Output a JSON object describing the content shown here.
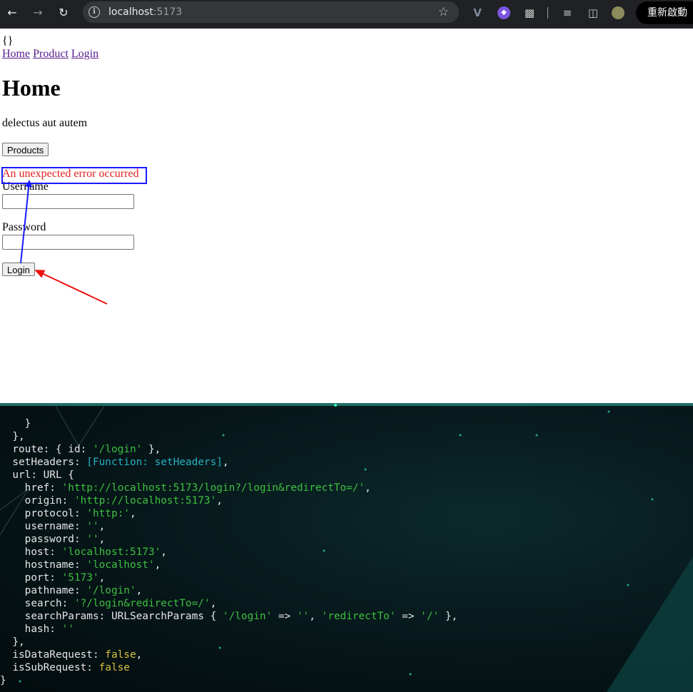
{
  "browser": {
    "url_host": "localhost",
    "url_port": ":5173",
    "restart_label": "重新啟動"
  },
  "page": {
    "braces": "{}",
    "nav": [
      "Home",
      "Product",
      "Login"
    ],
    "title": "Home",
    "description": "delectus aut autem",
    "products_button": "Products",
    "error_message": "An unexpected error occurred",
    "username_label": "Username",
    "password_label": "Password",
    "login_button": "Login"
  },
  "annotations": {
    "error_box_color": "#1a1aff",
    "blue_arrow_color": "#1a1aff",
    "red_arrow_color": "#ee1111"
  },
  "terminal": {
    "lines": [
      [
        [
          "    }",
          ""
        ]
      ],
      [
        [
          "  },",
          ""
        ]
      ],
      [
        [
          "  route: { id: ",
          ""
        ],
        [
          "'/login'",
          "g"
        ],
        [
          " },",
          ""
        ]
      ],
      [
        [
          "  setHeaders: ",
          ""
        ],
        [
          "[Function: setHeaders]",
          "c"
        ],
        [
          ",",
          ""
        ]
      ],
      [
        [
          "  url: URL {",
          ""
        ]
      ],
      [
        [
          "    href: ",
          ""
        ],
        [
          "'http://localhost:5173/login?/login&redirectTo=/'",
          "g"
        ],
        [
          ",",
          ""
        ]
      ],
      [
        [
          "    origin: ",
          ""
        ],
        [
          "'http://localhost:5173'",
          "g"
        ],
        [
          ",",
          ""
        ]
      ],
      [
        [
          "    protocol: ",
          ""
        ],
        [
          "'http:'",
          "g"
        ],
        [
          ",",
          ""
        ]
      ],
      [
        [
          "    username: ",
          ""
        ],
        [
          "''",
          "g"
        ],
        [
          ",",
          ""
        ]
      ],
      [
        [
          "    password: ",
          ""
        ],
        [
          "''",
          "g"
        ],
        [
          ",",
          ""
        ]
      ],
      [
        [
          "    host: ",
          ""
        ],
        [
          "'localhost:5173'",
          "g"
        ],
        [
          ",",
          ""
        ]
      ],
      [
        [
          "    hostname: ",
          ""
        ],
        [
          "'localhost'",
          "g"
        ],
        [
          ",",
          ""
        ]
      ],
      [
        [
          "    port: ",
          ""
        ],
        [
          "'5173'",
          "g"
        ],
        [
          ",",
          ""
        ]
      ],
      [
        [
          "    pathname: ",
          ""
        ],
        [
          "'/login'",
          "g"
        ],
        [
          ",",
          ""
        ]
      ],
      [
        [
          "    search: ",
          ""
        ],
        [
          "'?/login&redirectTo=/'",
          "g"
        ],
        [
          ",",
          ""
        ]
      ],
      [
        [
          "    searchParams: URLSearchParams { ",
          ""
        ],
        [
          "'/login'",
          "g"
        ],
        [
          " => ",
          ""
        ],
        [
          "''",
          "g"
        ],
        [
          ", ",
          ""
        ],
        [
          "'redirectTo'",
          "g"
        ],
        [
          " => ",
          ""
        ],
        [
          "'/'",
          "g"
        ],
        [
          " },",
          ""
        ]
      ],
      [
        [
          "    hash: ",
          ""
        ],
        [
          "''",
          "g"
        ]
      ],
      [
        [
          "  },",
          ""
        ]
      ],
      [
        [
          "  isDataRequest: ",
          ""
        ],
        [
          "false",
          "y"
        ],
        [
          ",",
          ""
        ]
      ],
      [
        [
          "  isSubRequest: ",
          ""
        ],
        [
          "false",
          "y"
        ]
      ],
      [
        [
          "}",
          ""
        ]
      ]
    ]
  }
}
